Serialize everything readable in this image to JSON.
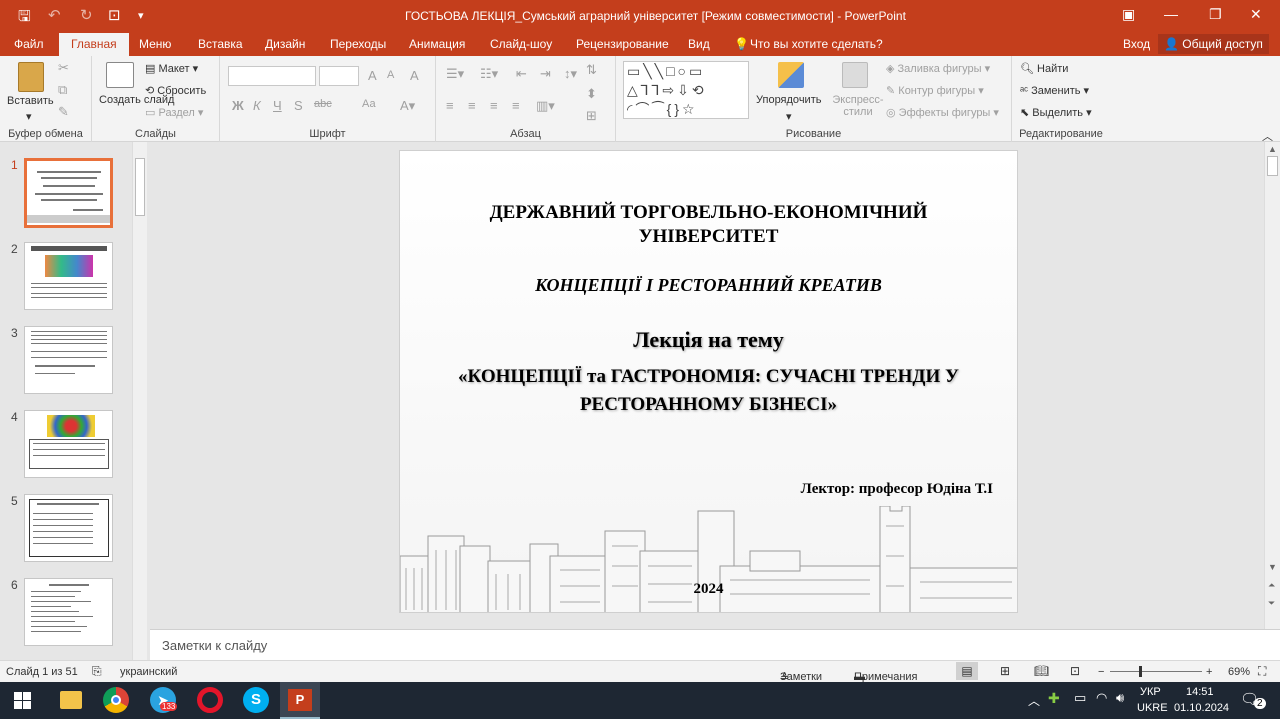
{
  "window": {
    "title": "ГОСТЬОВА  ЛЕКЦІЯ_Сумський аграрний університет [Режим совместимости] - PowerPoint"
  },
  "tabs": [
    {
      "label": "Файл"
    },
    {
      "label": "Главная"
    },
    {
      "label": "Меню"
    },
    {
      "label": "Вставка"
    },
    {
      "label": "Дизайн"
    },
    {
      "label": "Переходы"
    },
    {
      "label": "Анимация"
    },
    {
      "label": "Слайд-шоу"
    },
    {
      "label": "Рецензирование"
    },
    {
      "label": "Вид"
    }
  ],
  "tell_me": "Что вы хотите сделать?",
  "account": {
    "signin": "Вход",
    "share": "Общий доступ"
  },
  "ribbon": {
    "clipboard": {
      "paste": "Вставить",
      "label": "Буфер обмена"
    },
    "slides": {
      "new_slide": "Создать слайд",
      "layout": "Макет",
      "reset": "Сбросить",
      "section": "Раздел",
      "label": "Слайды"
    },
    "font": {
      "bold": "Ж",
      "italic": "К",
      "underline": "Ч",
      "strike": "S",
      "spacing": "abc",
      "case": "Аа",
      "grow": "A",
      "shrink": "A",
      "clear": "A",
      "label": "Шрифт"
    },
    "paragraph": {
      "label": "Абзац"
    },
    "drawing": {
      "arrange": "Упорядочить",
      "quick_styles": "Экспресс-стили",
      "fill": "Заливка фигуры",
      "outline": "Контур фигуры",
      "effects": "Эффекты фигуры",
      "label": "Рисование"
    },
    "editing": {
      "find": "Найти",
      "replace": "Заменить",
      "select": "Выделить",
      "label": "Редактирование"
    }
  },
  "thumbnails": [
    "1",
    "2",
    "3",
    "4",
    "5",
    "6"
  ],
  "slide": {
    "university": "ДЕРЖАВНИЙ ТОРГОВЕЛЬНО-ЕКОНОМІЧНИЙ УНІВЕРСИТЕТ",
    "course": "КОНЦЕПЦІЇ  І   РЕСТОРАННИЙ   КРЕАТИВ",
    "lecture": "Лекція на тему",
    "topic": "«КОНЦЕПЦІЇ та ГАСТРОНОМІЯ: СУЧАСНІ ТРЕНДИ У РЕСТОРАННОМУ БІЗНЕСІ»",
    "lecturer": "Лектор: професор   Юдіна Т.І",
    "year": "2024"
  },
  "notes_placeholder": "Заметки к слайду",
  "status": {
    "slide_info": "Слайд 1 из 51",
    "language": "украинский",
    "notes": "Заметки",
    "comments": "Примечания",
    "zoom": "69%"
  },
  "taskbar": {
    "lang1": "УКР",
    "lang2": "UKRE",
    "time": "14:51",
    "date": "01.10.2024",
    "telegram_badge": "133",
    "notify_count": "2"
  }
}
